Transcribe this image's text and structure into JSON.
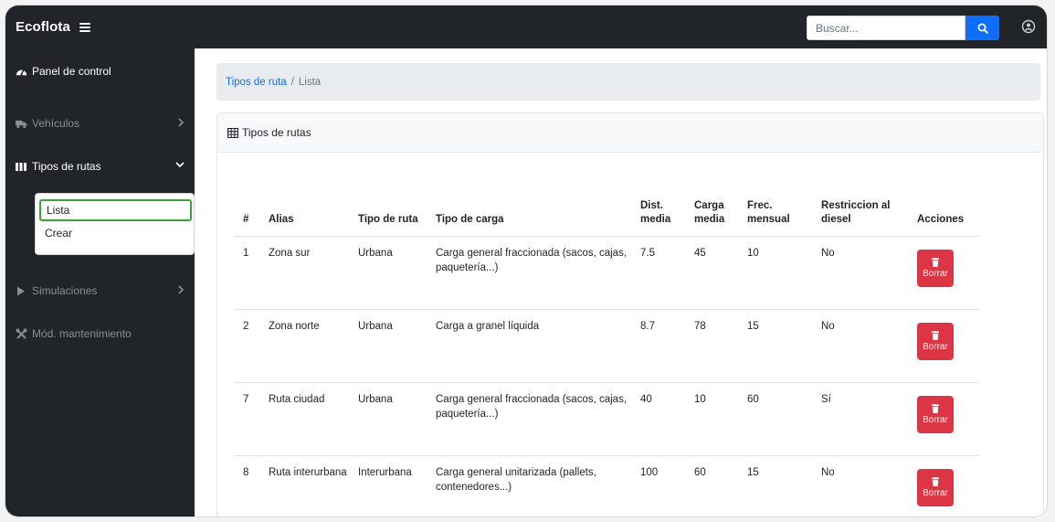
{
  "navbar": {
    "brand": "Ecoflota",
    "menu_icon": "bars-icon",
    "search_placeholder": "Buscar...",
    "search_icon": "search-icon",
    "user_icon": "user-circle-icon"
  },
  "sidebar": {
    "items": [
      {
        "label": "Panel de control",
        "icon": "tachometer-icon",
        "state": "bright"
      },
      {
        "label": "Vehículos",
        "icon": "truck-icon",
        "state": "dim",
        "chevron": "chevron-right-icon"
      },
      {
        "label": "Tipos de rutas",
        "icon": "columns-icon",
        "state": "bright",
        "chevron": "chevron-down-icon"
      },
      {
        "label": "Simulaciones",
        "icon": "play-icon",
        "state": "dim",
        "chevron": "chevron-right-icon"
      },
      {
        "label": "Mód. mantenimiento",
        "icon": "tools-icon",
        "state": "dim"
      }
    ],
    "submenu": [
      {
        "label": "Lista",
        "active": true
      },
      {
        "label": "Crear",
        "active": false
      }
    ]
  },
  "breadcrumb": {
    "link": "Tipos de ruta",
    "separator": "/",
    "current": "Lista"
  },
  "card": {
    "title": "Tipos de rutas",
    "icon": "table-icon"
  },
  "table": {
    "headers": [
      "#",
      "Alias",
      "Tipo de ruta",
      "Tipo de carga",
      "Dist. media",
      "Carga media",
      "Frec. mensual",
      "Restriccion al diesel",
      "Acciones"
    ],
    "rows": [
      {
        "id": "1",
        "alias": "Zona sur",
        "tipo_ruta": "Urbana",
        "tipo_carga": "Carga general fraccionada (sacos, cajas, paquetería...)",
        "dist": "7.5",
        "carga": "45",
        "frec": "10",
        "restriccion": "No"
      },
      {
        "id": "2",
        "alias": "Zona norte",
        "tipo_ruta": "Urbana",
        "tipo_carga": "Carga a granel líquida",
        "dist": "8.7",
        "carga": "78",
        "frec": "15",
        "restriccion": "No"
      },
      {
        "id": "7",
        "alias": "Ruta ciudad",
        "tipo_ruta": "Urbana",
        "tipo_carga": "Carga general fraccionada (sacos, cajas, paquetería...)",
        "dist": "40",
        "carga": "10",
        "frec": "60",
        "restriccion": "Sí"
      },
      {
        "id": "8",
        "alias": "Ruta interurbana",
        "tipo_ruta": "Interurbana",
        "tipo_carga": "Carga general unitarizada (pallets, contenedores...)",
        "dist": "100",
        "carga": "60",
        "frec": "15",
        "restriccion": "No"
      }
    ],
    "delete_label": "Borrar",
    "delete_icon": "trash-icon"
  },
  "colors": {
    "navbar_bg": "#212529",
    "primary": "#0d6efd",
    "danger": "#dc3545",
    "active_outline": "#3aa335"
  }
}
